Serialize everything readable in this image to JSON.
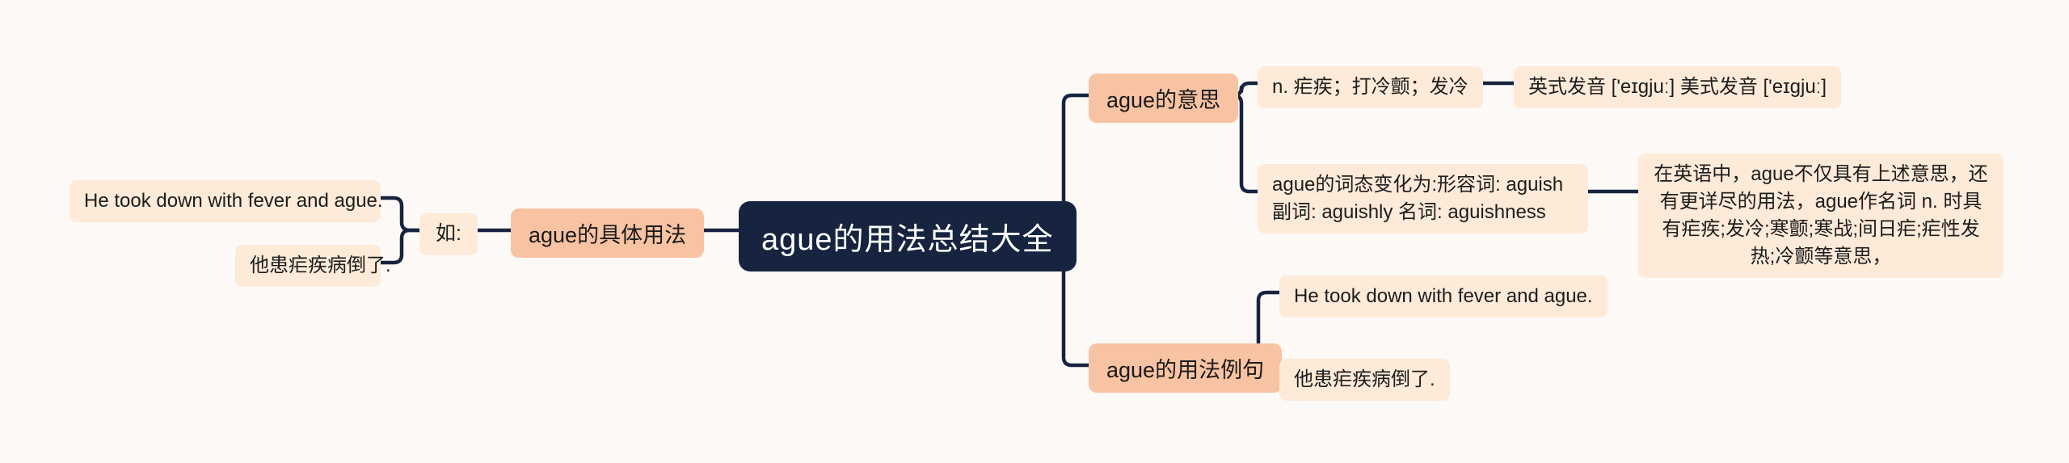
{
  "map": {
    "title": "ague的用法总结大全",
    "background_color": "#fdf9f7",
    "root_color": "#16243f",
    "branch_color": "#f8c3a2",
    "leaf_color": "#fdead8",
    "link_color": "#16243f"
  },
  "root": {
    "label": "ague的用法总结大全"
  },
  "left": {
    "branch": {
      "label": "ague的具体用法"
    },
    "connector": {
      "label": "如:"
    },
    "examples": [
      {
        "label": "He took down with fever and ague."
      },
      {
        "label": "他患疟疾病倒了."
      }
    ]
  },
  "right": {
    "branches": [
      {
        "label": "ague的意思",
        "children": [
          {
            "label": "n. 疟疾；打冷颤；发冷",
            "children": [
              {
                "label": "英式发音 ['eɪgjuː] 美式发音 ['eɪgjuː]"
              }
            ]
          },
          {
            "label": "ague的词态变化为:形容词: aguish 副词: aguishly 名词: aguishness",
            "children": [
              {
                "label": "在英语中，ague不仅具有上述意思，还有更详尽的用法，ague作名词 n. 时具有疟疾;发冷;寒颤;寒战;间日疟;疟性发热;冷颤等意思，"
              }
            ]
          }
        ]
      },
      {
        "label": "ague的用法例句",
        "children": [
          {
            "label": "He took down with fever and ague."
          },
          {
            "label": "他患疟疾病倒了."
          }
        ]
      }
    ]
  }
}
